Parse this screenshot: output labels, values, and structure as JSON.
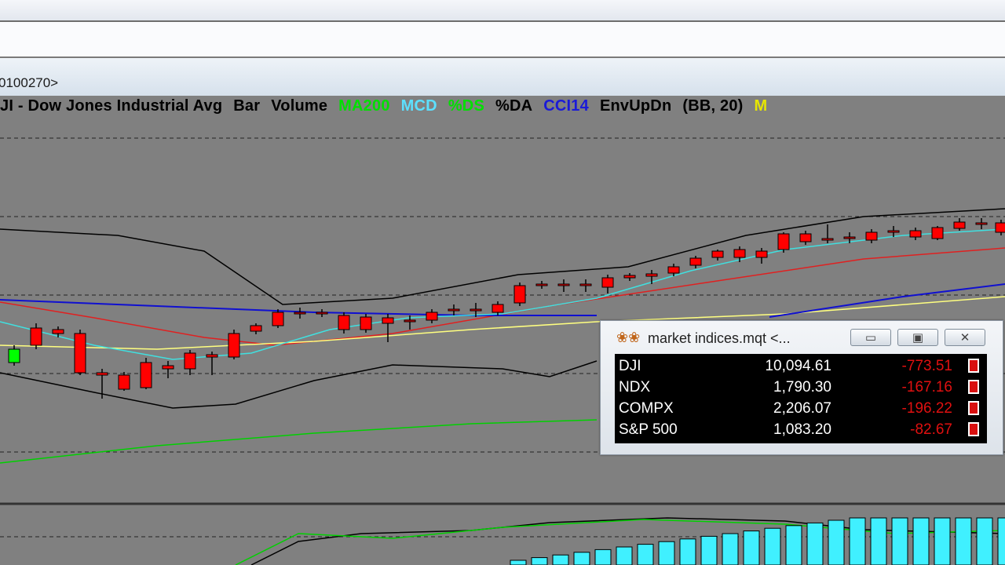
{
  "address": {
    "text": "0100270>"
  },
  "legend": {
    "items": [
      {
        "text": "JI - Dow Jones Industrial Avg",
        "color": "#000000"
      },
      {
        "text": "Bar",
        "color": "#000000"
      },
      {
        "text": "Volume",
        "color": "#000000"
      },
      {
        "text": "MA200",
        "color": "#00e000"
      },
      {
        "text": "MCD",
        "color": "#5ce0ff"
      },
      {
        "text": "%DS",
        "color": "#00e000"
      },
      {
        "text": "%DA",
        "color": "#000000"
      },
      {
        "text": "CCI14",
        "color": "#1a1ad8"
      },
      {
        "text": "EnvUpDn",
        "color": "#000000"
      },
      {
        "text": "(BB, 20)",
        "color": "#000000"
      },
      {
        "text": "M",
        "color": "#e6e600"
      }
    ]
  },
  "colors": {
    "up_candle": "#00ff00",
    "down_candle": "#ff0000",
    "ma_red": "#e02020",
    "ma_cyan": "#40e0e0",
    "ma_yellow": "#ffff80",
    "ma_blue": "#1010d0",
    "ma200_green": "#00d000",
    "band": "#000000",
    "volume": "#40f0ff"
  },
  "popup": {
    "icon": "quote-chain-icon",
    "title": "market indices.mqt <...",
    "minimize_icon": "minimize-icon",
    "restore_icon": "restore-icon",
    "close_icon": "close-icon",
    "rows": [
      {
        "symbol": "DJI",
        "last": "10,094.61",
        "change": "-773.51"
      },
      {
        "symbol": "NDX",
        "last": "1,790.30",
        "change": "-167.16"
      },
      {
        "symbol": "COMPX",
        "last": "2,206.07",
        "change": "-196.22"
      },
      {
        "symbol": "S&P 500",
        "last": "1,083.20",
        "change": "-82.67"
      }
    ]
  }
}
